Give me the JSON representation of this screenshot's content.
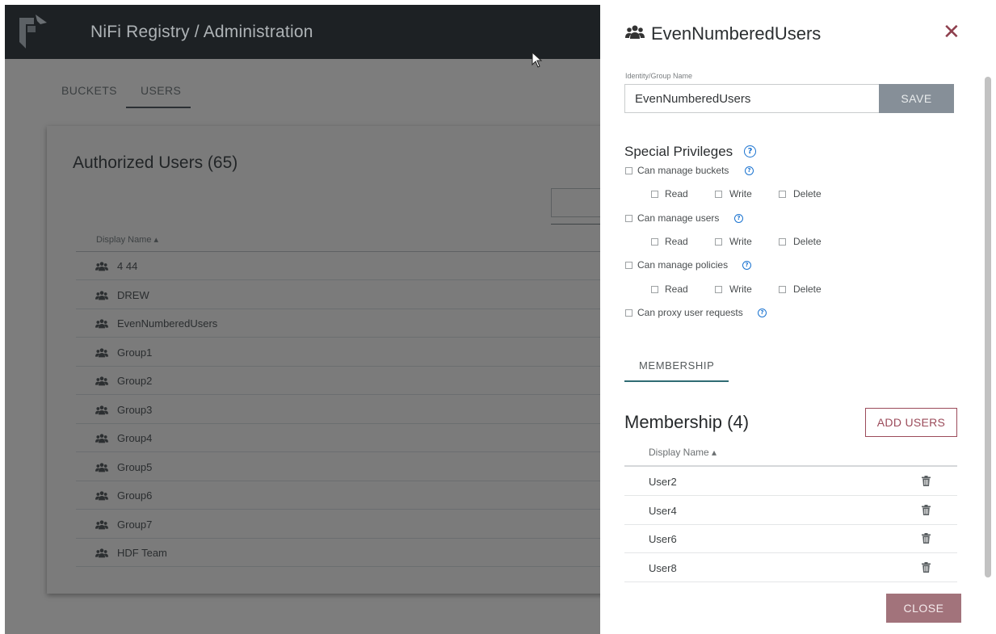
{
  "app": {
    "title": "NiFi Registry / Administration",
    "tabs": [
      {
        "label": "BUCKETS"
      },
      {
        "label": "USERS",
        "active": true
      }
    ]
  },
  "users_card": {
    "title": "Authorized Users (65)",
    "column_header": "Display Name ▴",
    "rows": [
      {
        "name": "4 44"
      },
      {
        "name": "DREW"
      },
      {
        "name": "EvenNumberedUsers"
      },
      {
        "name": "Group1"
      },
      {
        "name": "Group2"
      },
      {
        "name": "Group3"
      },
      {
        "name": "Group4"
      },
      {
        "name": "Group5"
      },
      {
        "name": "Group6"
      },
      {
        "name": "Group7"
      },
      {
        "name": "HDF Team"
      }
    ]
  },
  "panel": {
    "title": "EvenNumberedUsers",
    "close_x": "✕",
    "identity_label": "Identity/Group Name",
    "identity_value": "EvenNumberedUsers",
    "save_label": "SAVE",
    "special_privileges": {
      "heading": "Special Privileges",
      "help": "?",
      "manage_buckets": "Can manage buckets",
      "manage_users": "Can manage users",
      "manage_policies": "Can manage policies",
      "proxy_requests": "Can proxy user requests",
      "read": "Read",
      "write": "Write",
      "delete": "Delete"
    },
    "membership_tab": "MEMBERSHIP",
    "membership_title": "Membership (4)",
    "add_users_label": "ADD USERS",
    "membership_column_header": "Display Name ▴",
    "members": [
      {
        "name": "User2"
      },
      {
        "name": "User4"
      },
      {
        "name": "User6"
      },
      {
        "name": "User8"
      }
    ],
    "close_label": "CLOSE"
  },
  "colors": {
    "accent_maroon": "#9b4b5a",
    "help_blue": "#1a73d0",
    "save_gray": "#868f98",
    "close_button": "#a2737b",
    "topbar": "#1d2124"
  },
  "icons": {
    "logo": "nifi-registry-logo",
    "group": "users-group-icon",
    "trash": "trash-icon",
    "help": "help-circle-icon",
    "cursor": "mouse-pointer-icon"
  }
}
